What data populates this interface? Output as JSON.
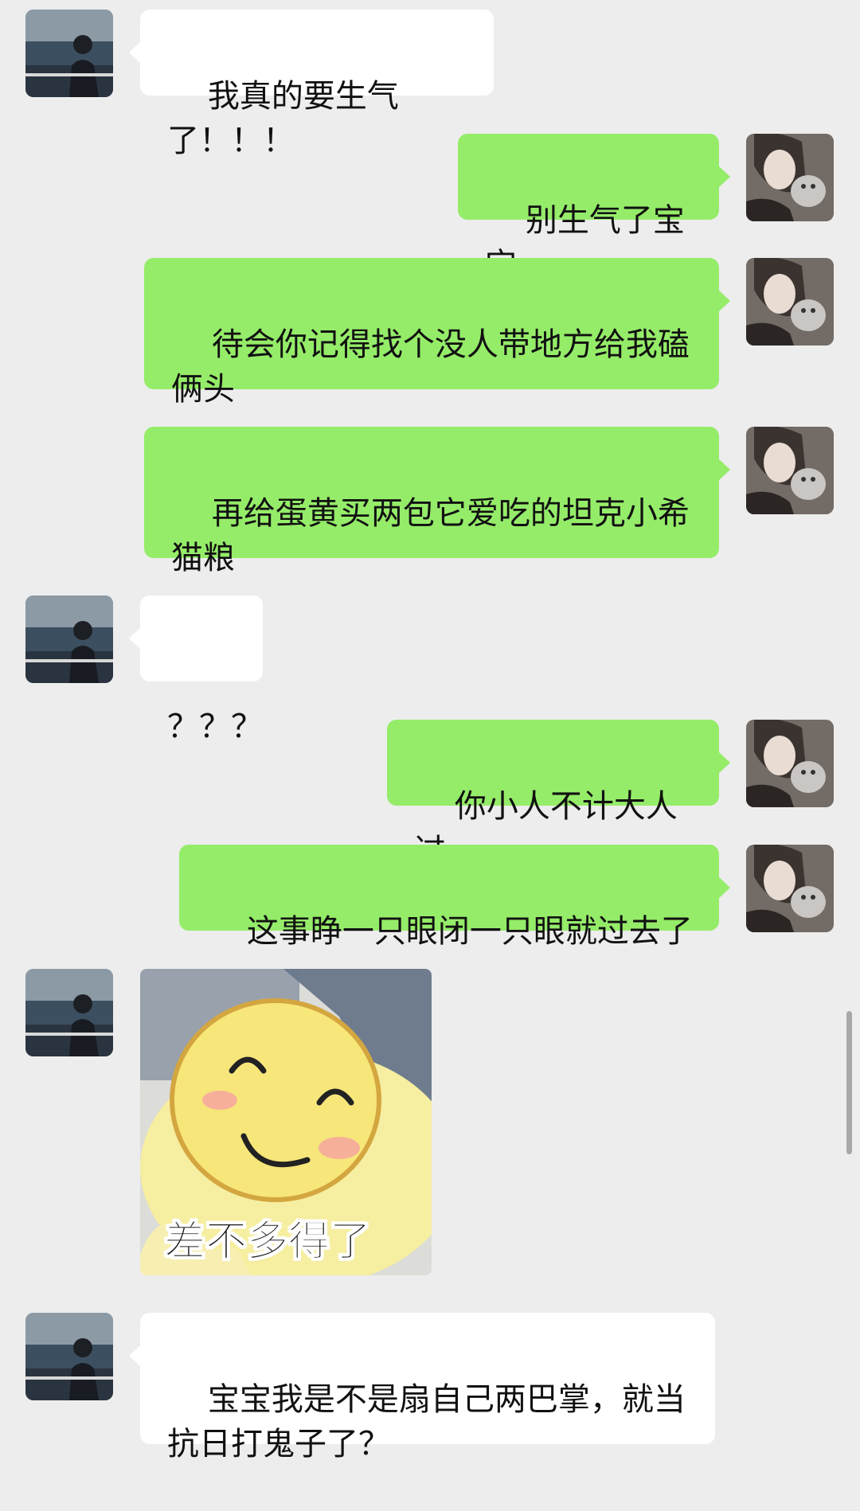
{
  "messages": [
    {
      "side": "left",
      "text": "我真的要生气了！！！"
    },
    {
      "side": "right",
      "text": "别生气了宝宝"
    },
    {
      "side": "right",
      "text": "待会你记得找个没人带地方给我磕俩头"
    },
    {
      "side": "right",
      "text": "再给蛋黄买两包它爱吃的坦克小希猫粮"
    },
    {
      "side": "left",
      "text": "？？？"
    },
    {
      "side": "right",
      "text": "你小人不计大人过"
    },
    {
      "side": "right",
      "text": "这事睁一只眼闭一只眼就过去了"
    },
    {
      "side": "left",
      "type": "sticker",
      "caption": "差不多得了"
    },
    {
      "side": "left",
      "text": "宝宝我是不是扇自己两巴掌，就当抗日打鬼子了？"
    }
  ],
  "colors": {
    "background": "#ededed",
    "incoming_bubble": "#ffffff",
    "outgoing_bubble": "#95ec69"
  },
  "icons": {
    "left_avatar": "man-at-sea-avatar",
    "right_avatar": "girl-with-cat-avatar"
  }
}
